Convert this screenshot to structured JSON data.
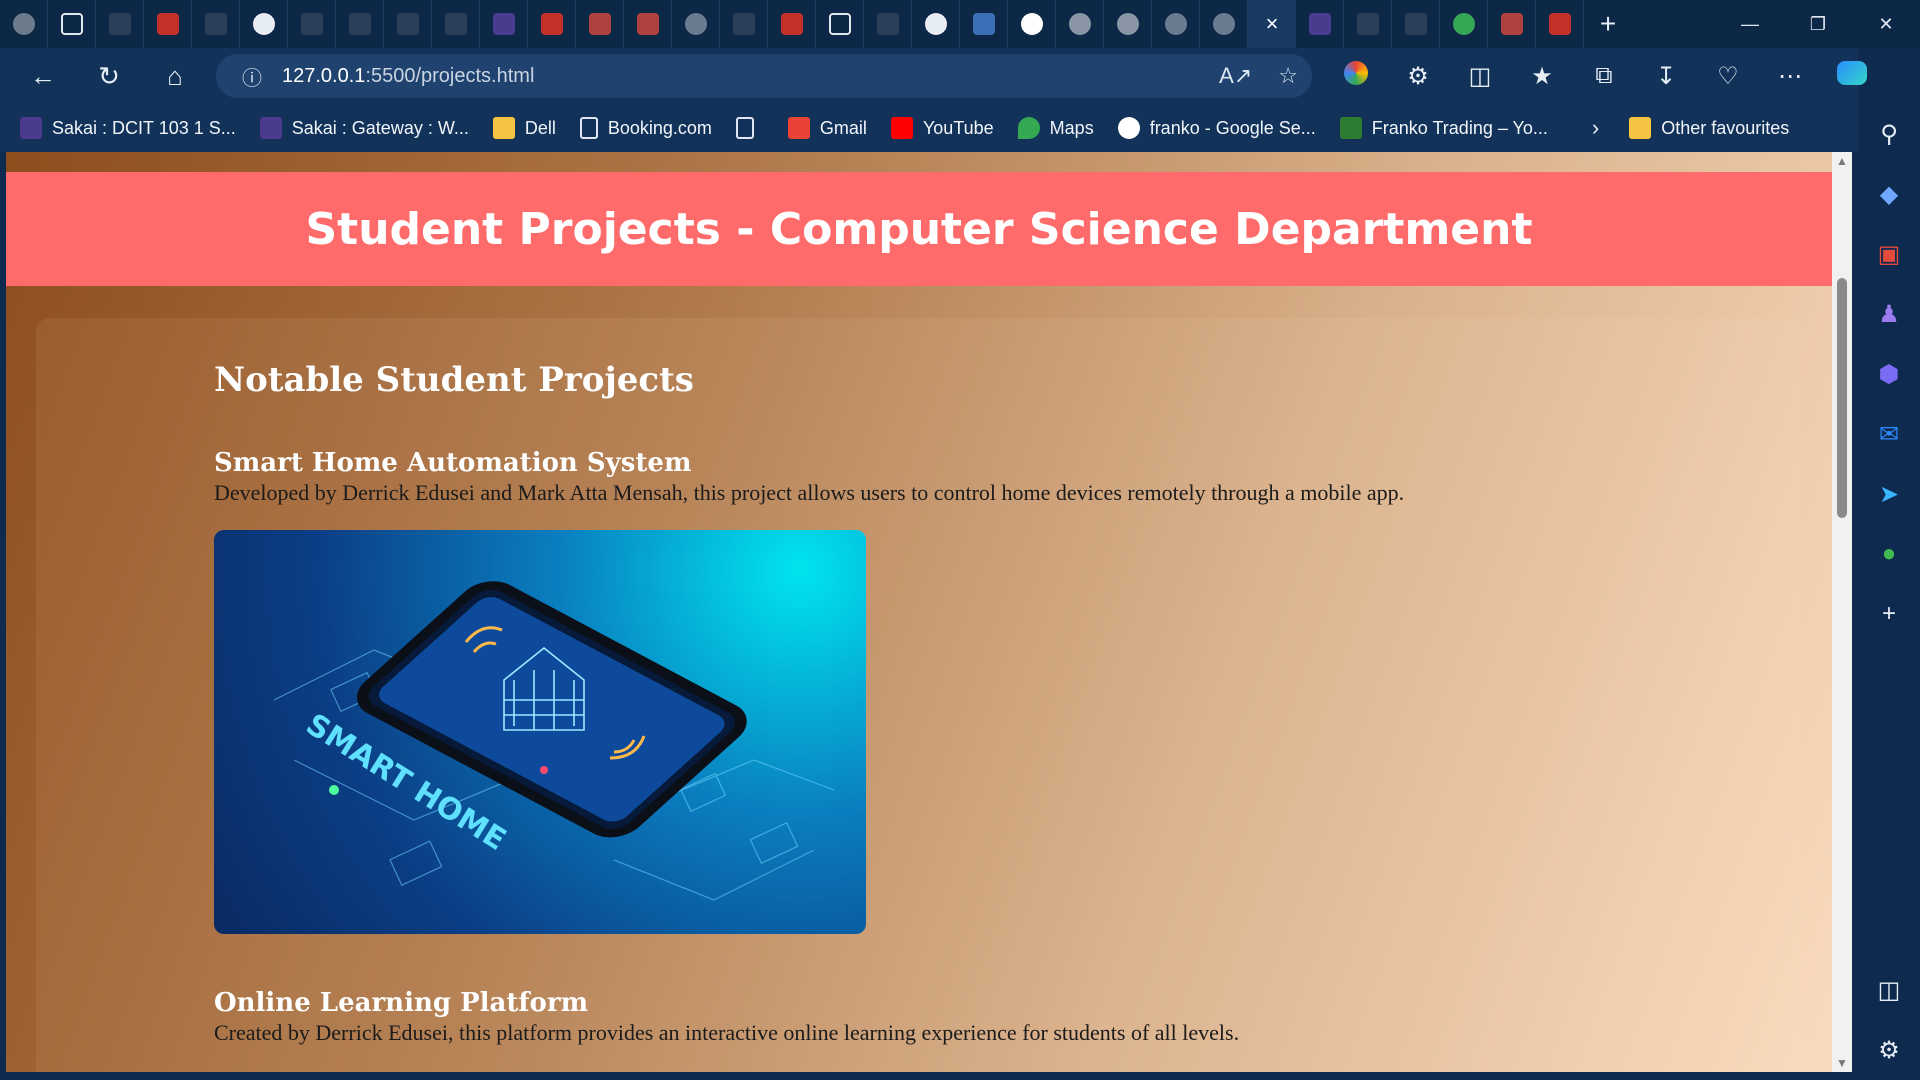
{
  "browser": {
    "url_host": "127.0.0.1",
    "url_path": ":5500/projects.html",
    "tab_close_glyph": "×",
    "new_tab_glyph": "+"
  },
  "bookmarks": [
    {
      "label": "Sakai : DCIT 103 1 S...",
      "icon": "sakai-icon",
      "color": "#4b3b8f"
    },
    {
      "label": "Sakai : Gateway : W...",
      "icon": "sakai-icon",
      "color": "#4b3b8f"
    },
    {
      "label": "Dell",
      "icon": "folder-icon",
      "color": "#f5c242"
    },
    {
      "label": "Booking.com",
      "icon": "page-icon",
      "color": "#dfe6ef"
    },
    {
      "label": "",
      "icon": "page-icon",
      "color": "#dfe6ef"
    },
    {
      "label": "Gmail",
      "icon": "gmail-icon",
      "color": "#ea4335"
    },
    {
      "label": "YouTube",
      "icon": "youtube-icon",
      "color": "#ff0000"
    },
    {
      "label": "Maps",
      "icon": "maps-icon",
      "color": "#34a853"
    },
    {
      "label": "franko - Google Se...",
      "icon": "google-icon",
      "color": "#ffffff"
    },
    {
      "label": "Franko Trading – Yo...",
      "icon": "franko-icon",
      "color": "#2e7d32"
    }
  ],
  "other_favourites": "Other favourites",
  "page": {
    "banner_title": "Student Projects - Computer Science Department",
    "section_title": "Notable Student Projects",
    "projects": [
      {
        "title": "Smart Home Automation System",
        "description": "Developed by Derrick Edusei and Mark Atta Mensah, this project allows users to control home devices remotely through a mobile app.",
        "image_alt": "SMART HOME"
      },
      {
        "title": "Online Learning Platform",
        "description": "Created by Derrick Edusei, this platform provides an interactive online learning experience for students of all levels."
      }
    ]
  },
  "colors": {
    "banner": "#ff6b6b",
    "browser_chrome": "#123259",
    "tabbar": "#0d2747"
  }
}
